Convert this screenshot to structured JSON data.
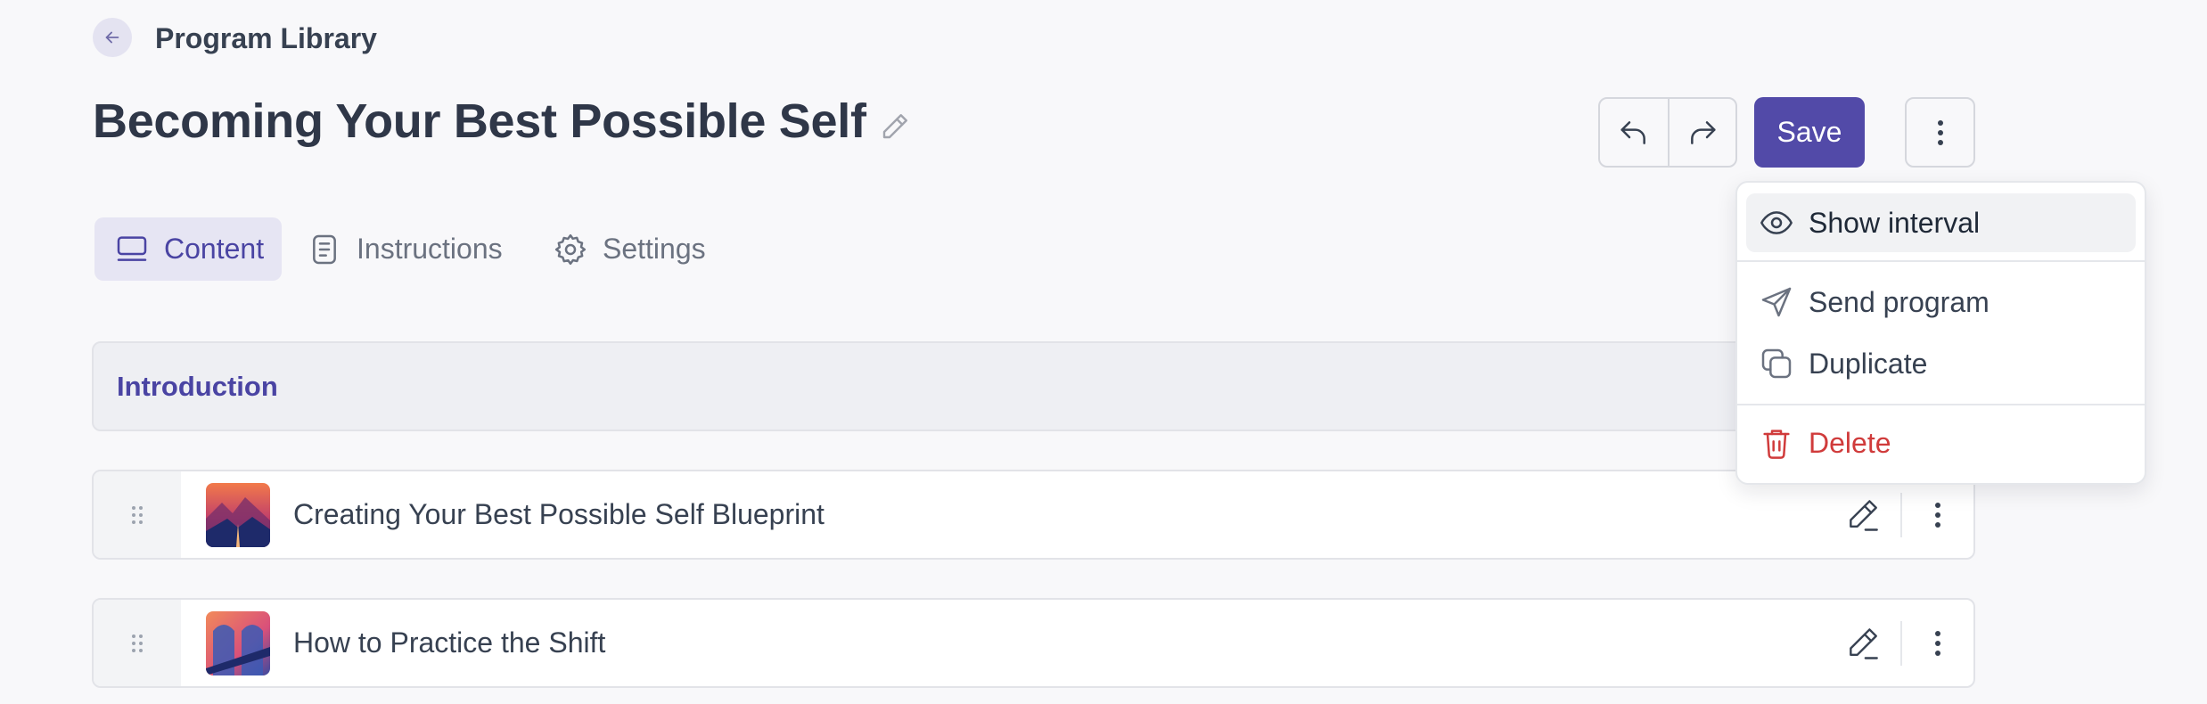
{
  "breadcrumb": {
    "back_icon": "arrow-left-icon",
    "label": "Program Library"
  },
  "program": {
    "title": "Becoming Your Best Possible Self"
  },
  "toolbar": {
    "save_label": "Save"
  },
  "tabs": [
    {
      "label": "Content",
      "icon": "monitor-icon",
      "active": true
    },
    {
      "label": "Instructions",
      "icon": "document-icon",
      "active": false
    },
    {
      "label": "Settings",
      "icon": "gear-icon",
      "active": false
    }
  ],
  "section": {
    "title": "Introduction"
  },
  "items": [
    {
      "label": "Creating Your Best Possible Self Blueprint"
    },
    {
      "label": "How to Practice the Shift"
    }
  ],
  "menu": {
    "items": [
      {
        "label": "Show interval",
        "icon": "eye-icon"
      },
      {
        "label": "Send program",
        "icon": "send-icon"
      },
      {
        "label": "Duplicate",
        "icon": "copy-icon"
      },
      {
        "label": "Delete",
        "icon": "trash-icon"
      }
    ]
  },
  "colors": {
    "accent": "#524aa8",
    "accent_text": "#4a44a3",
    "danger": "#d03b3b",
    "background": "#f8f8fa"
  }
}
